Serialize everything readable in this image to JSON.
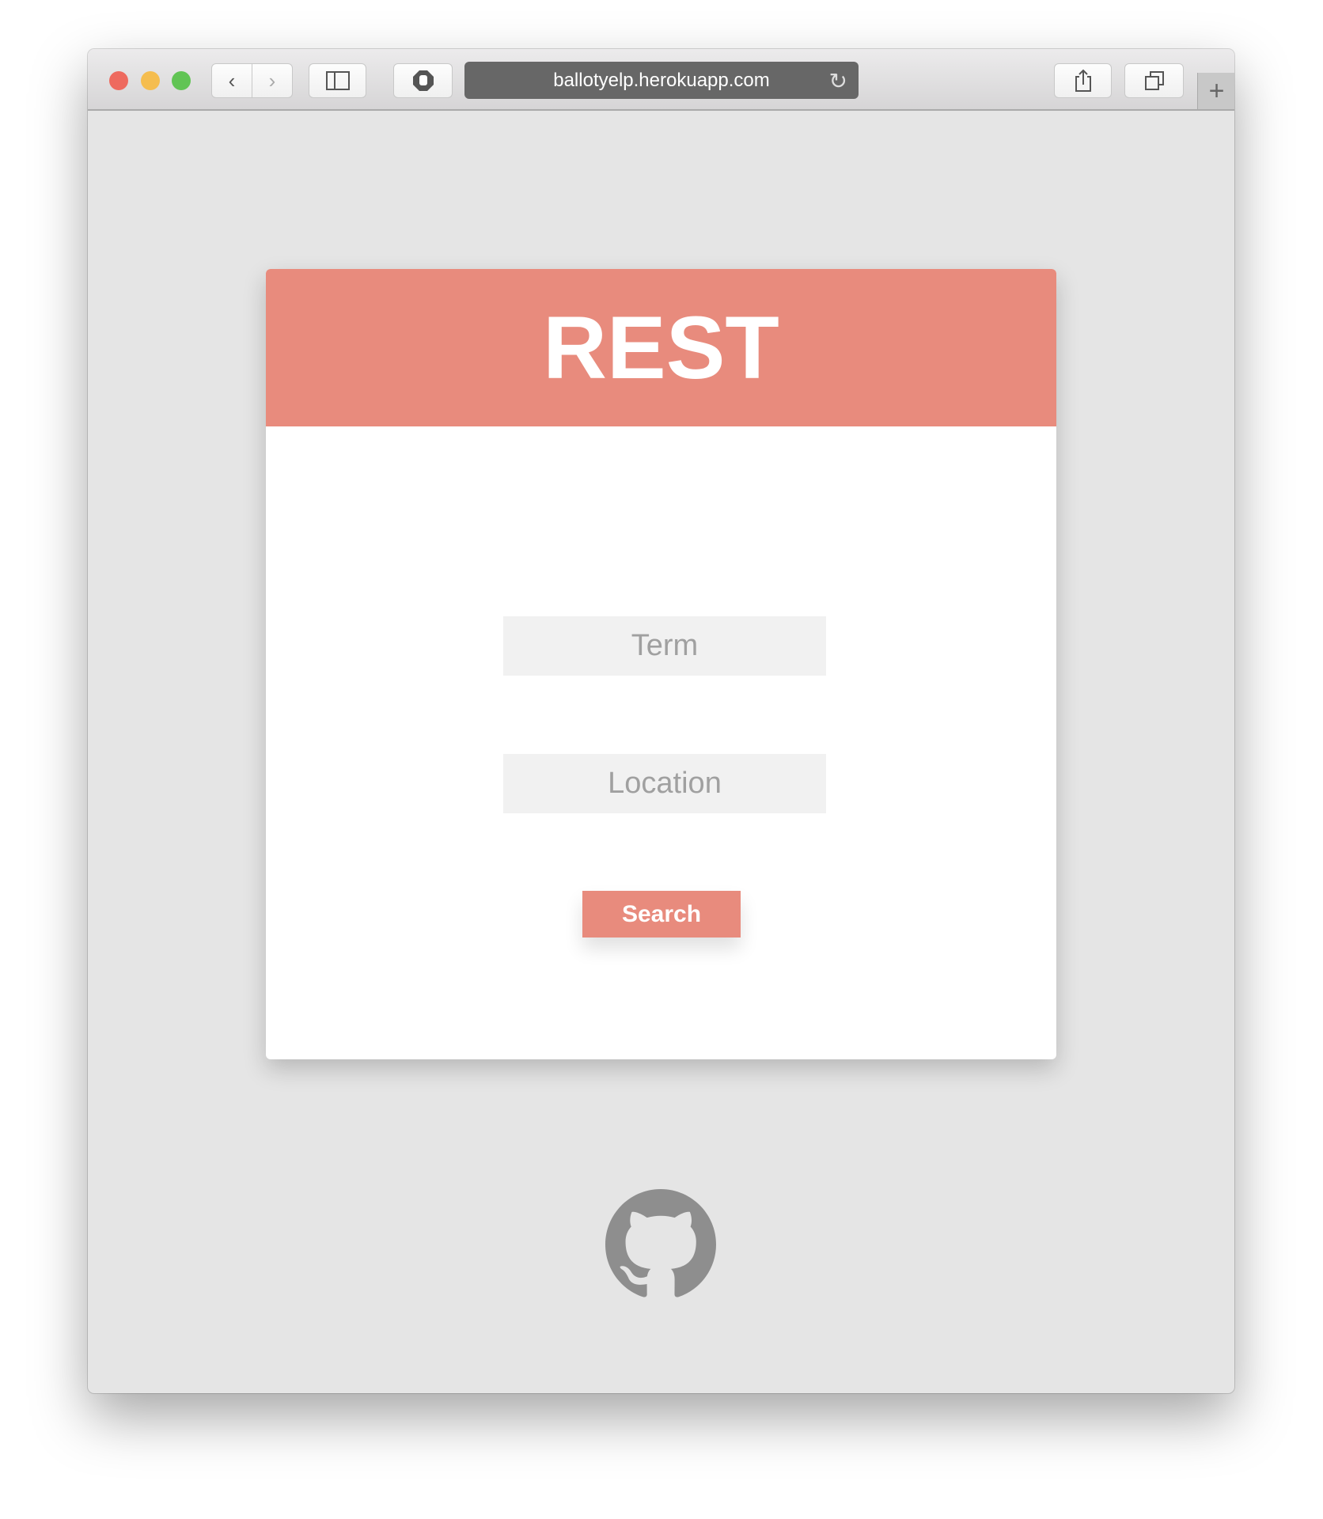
{
  "browser": {
    "url": "ballotyelp.herokuapp.com",
    "traffic_lights": {
      "close": "#ee6a5f",
      "minimize": "#f5bd4f",
      "maximize": "#61c454"
    },
    "icons": [
      "chevron-left-icon",
      "chevron-right-icon",
      "sidebar-icon",
      "hand-stop-icon",
      "reload-icon",
      "share-icon",
      "tabs-icon",
      "plus-icon"
    ]
  },
  "app": {
    "title": "REST",
    "accent": "#e88b7d",
    "term_placeholder": "Term",
    "location_placeholder": "Location",
    "search_label": "Search",
    "footer_icon": "github-icon"
  }
}
